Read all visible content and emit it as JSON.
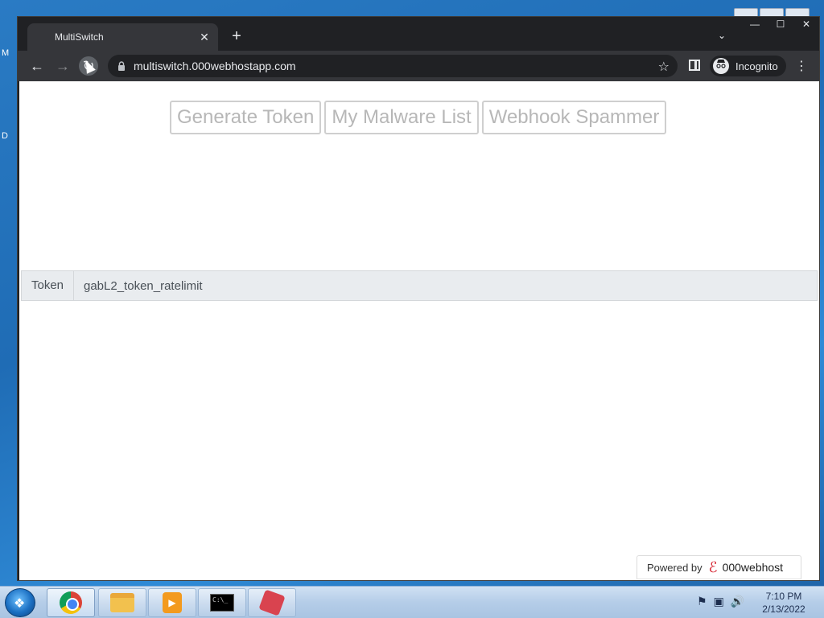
{
  "desktop": {
    "left_edge_chars": [
      "M",
      "D"
    ]
  },
  "browser": {
    "tab": {
      "title": "MultiSwitch",
      "close_glyph": "✕"
    },
    "new_tab_glyph": "+",
    "tab_search_glyph": "⌄",
    "window_controls": {
      "minimize": "—",
      "maximize": "☐",
      "close": "✕"
    },
    "nav": {
      "back": "←",
      "forward": "→",
      "reload": "↻"
    },
    "address": {
      "url": "multiswitch.000webhostapp.com",
      "lock_glyph": "🔒"
    },
    "bookmark_glyph": "☆",
    "profile": {
      "label": "Incognito",
      "icon": "incognito-icon"
    },
    "menu_glyph": "⋮"
  },
  "page": {
    "nav_buttons": [
      "Generate Token",
      "My Malware List",
      "Webhook Spammer"
    ],
    "token": {
      "label": "Token",
      "value": "gabL2_token_ratelimit"
    },
    "footer": {
      "powered_by": "Powered by",
      "brand": "000webhost",
      "logo_glyph": "ℰ"
    }
  },
  "taskbar": {
    "clock": {
      "time": "7:10 PM",
      "date": "2/13/2022"
    },
    "apps": [
      "chrome",
      "explorer",
      "media-player",
      "command-prompt",
      "app"
    ]
  }
}
